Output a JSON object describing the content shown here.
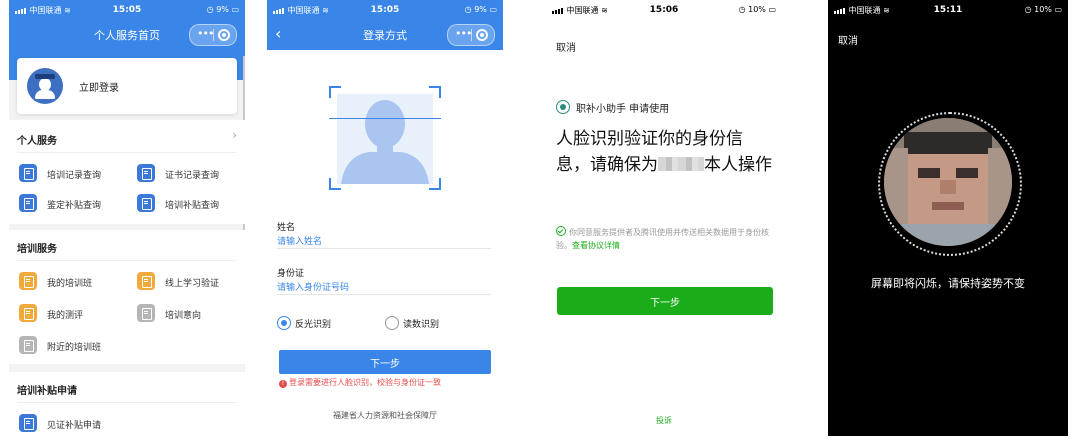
{
  "screens": {
    "home": {
      "status": {
        "carrier": "中国联通",
        "time": "15:05",
        "battery": "9%"
      },
      "title": "个人服务首页",
      "login_label": "立即登录",
      "personal_section": {
        "title": "个人服务",
        "items": [
          "培训记录查询",
          "证书记录查询",
          "鉴定补贴查询",
          "培训补贴查询"
        ]
      },
      "training_section": {
        "title": "培训服务",
        "items": [
          "我的培训班",
          "线上学习验证",
          "我的测评",
          "培训意向",
          "附近的培训班"
        ]
      },
      "subsidy_section": {
        "title": "培训补贴申请",
        "items": [
          "见证补贴申请"
        ]
      }
    },
    "login": {
      "status": {
        "carrier": "中国联通",
        "time": "15:05",
        "battery": "9%"
      },
      "title": "登录方式",
      "name_label": "姓名",
      "name_placeholder": "请输入姓名",
      "id_label": "身份证",
      "id_placeholder": "请输入身份证号码",
      "radio_reflect": "反光识别",
      "radio_read": "读数识别",
      "next_button": "下一步",
      "warning": "登录需要进行人脸识别，校验与身份证一致",
      "footer": "福建省人力资源和社会保障厅"
    },
    "auth": {
      "status": {
        "carrier": "中国联通",
        "time": "15:06",
        "battery": "10%"
      },
      "cancel": "取消",
      "app_line": "职补小助手 申请使用",
      "headline_part1": "人脸识别验证你的身份信息，请确保为",
      "headline_part2": "本人操作",
      "consent_text": "你同意服务提供者及腾讯使用并传送相关数据用于身份核验。",
      "consent_link": "查看协议详情",
      "next_button": "下一步",
      "complaint": "投诉"
    },
    "camera": {
      "status": {
        "carrier": "中国联通",
        "time": "15:11",
        "battery": "10%"
      },
      "cancel": "取消",
      "message": "屏幕即将闪烁，请保持姿势不变"
    }
  },
  "colors": {
    "primary_blue": "#3a86e8",
    "wechat_green": "#1aad19",
    "warning_red": "#e24c4c"
  }
}
